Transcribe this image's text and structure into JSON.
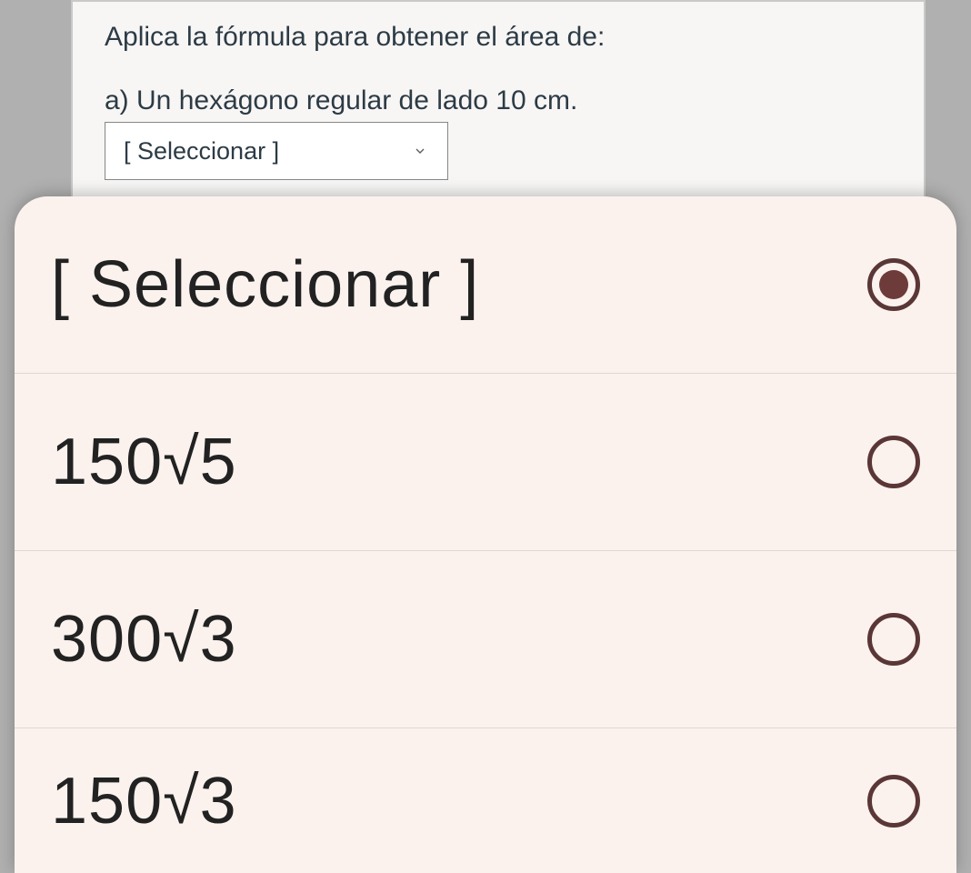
{
  "question": {
    "prompt": "Aplica la fórmula para obtener el área de:",
    "part_a": "a) Un hexágono regular de lado 10 cm."
  },
  "select": {
    "placeholder": "[ Seleccionar ]"
  },
  "sheet": {
    "options": [
      {
        "label": "[ Seleccionar ]",
        "selected": true
      },
      {
        "label": "150√5",
        "selected": false
      },
      {
        "label": "300√3",
        "selected": false
      },
      {
        "label": "150√3",
        "selected": false
      }
    ]
  }
}
